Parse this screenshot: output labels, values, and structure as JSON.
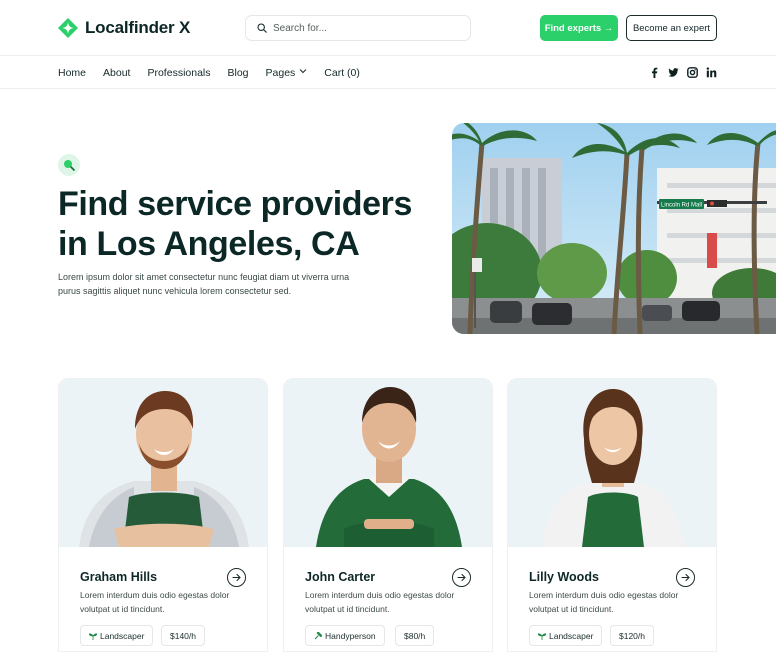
{
  "brand": {
    "name": "Localfinder X",
    "accent": "#2bd06b",
    "dark": "#0b2826"
  },
  "search": {
    "placeholder": "Search for..."
  },
  "header": {
    "find_label": "Find experts →",
    "become_label": "Become an expert"
  },
  "nav": {
    "items": [
      "Home",
      "About",
      "Professionals",
      "Blog",
      "Pages",
      "Cart (0)"
    ],
    "socials": [
      "facebook-icon",
      "twitter-icon",
      "instagram-icon",
      "linkedin-icon"
    ]
  },
  "hero": {
    "badge_icon": "search-icon",
    "title": "Find service providers in Los Angeles, CA",
    "description": "Lorem ipsum dolor sit amet consectetur nunc feugiat diam ut viverra urna purus sagittis aliquet nunc vehicula lorem consectetur sed.",
    "image_sign": "Lincoln Rd Mall"
  },
  "experts": [
    {
      "name": "Graham Hills",
      "description": "Lorem interdum duis odio egestas dolor volutpat ut id tincidunt.",
      "category": "Landscaper",
      "category_icon": "plant-icon",
      "rate": "$140/h"
    },
    {
      "name": "John Carter",
      "description": "Lorem interdum duis odio egestas dolor volutpat ut id tincidunt.",
      "category": "Handyperson",
      "category_icon": "hammer-icon",
      "rate": "$80/h"
    },
    {
      "name": "Lilly Woods",
      "description": "Lorem interdum duis odio egestas dolor volutpat ut id tincidunt.",
      "category": "Landscaper",
      "category_icon": "plant-icon",
      "rate": "$120/h"
    }
  ]
}
